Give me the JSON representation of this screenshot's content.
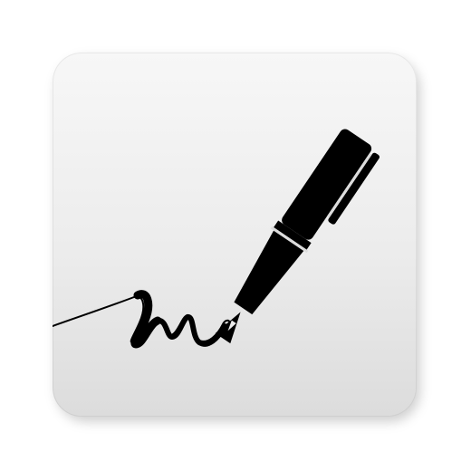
{
  "app_icon": {
    "icon": "pen-signature-icon",
    "background_colors": [
      "#f7f7f7",
      "#ececec",
      "#dcdcdc"
    ],
    "ink_color": "#000000"
  }
}
